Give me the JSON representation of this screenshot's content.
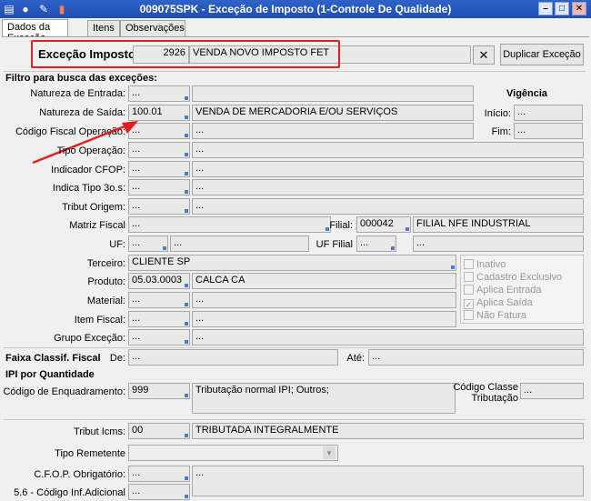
{
  "window": {
    "title": "009075SPK - Exceção de Imposto (1-Controle De Qualidade)",
    "min_label": "–",
    "max_label": "□",
    "close_label": "✕"
  },
  "tabs": [
    {
      "label": "Dados da Exceção"
    },
    {
      "label": "Itens"
    },
    {
      "label": "Observações"
    }
  ],
  "header": {
    "label": "Exceção Imposto",
    "code": "2926",
    "description": "VENDA NOVO IMPOSTO FET",
    "clear_icon": "✕",
    "duplicate_label": "Duplicar Exceção"
  },
  "filters": {
    "section_title": "Filtro para busca das exceções:",
    "vigencia_label": "Vigência",
    "inicio_label": "Início:",
    "inicio_value": "...",
    "fim_label": "Fim:",
    "fim_value": "...",
    "natureza_entrada": {
      "label": "Natureza de Entrada:",
      "code": "...",
      "desc": ""
    },
    "natureza_saida": {
      "label": "Natureza de Saída:",
      "code": "100.01",
      "desc": "VENDA DE MERCADORIA E/OU SERVIÇOS"
    },
    "cfop_operacao": {
      "label": "Código Fiscal Operação:",
      "code": "...",
      "desc": "..."
    },
    "tipo_operacao": {
      "label": "Tipo Operação:",
      "code": "...",
      "desc": "..."
    },
    "indicador_cfop": {
      "label": "Indicador CFOP:",
      "code": "...",
      "desc": "..."
    },
    "indica_tipo": {
      "label": "Indica Tipo 3o.s:",
      "code": "...",
      "desc": "..."
    },
    "tribut_origem": {
      "label": "Tribut Origem:",
      "code": "...",
      "desc": "..."
    },
    "matriz_fiscal": {
      "label": "Matriz Fiscal",
      "value": "..."
    },
    "filial": {
      "label": "Filial:",
      "code": "000042",
      "desc": "FILIAL NFE INDUSTRIAL"
    },
    "uf": {
      "label": "UF:",
      "code": "...",
      "desc": "..."
    },
    "uf_filial": {
      "label": "UF Filial",
      "code": "...",
      "desc": "..."
    },
    "terceiro": {
      "label": "Terceiro:",
      "value": "CLIENTE SP"
    },
    "produto": {
      "label": "Produto:",
      "code": "05.03.0003",
      "desc": "CALCA CA"
    },
    "material": {
      "label": "Material:",
      "code": "...",
      "desc": "..."
    },
    "item_fiscal": {
      "label": "Item Fiscal:",
      "code": "...",
      "desc": "..."
    },
    "grupo_excecao": {
      "label": "Grupo Exceção:",
      "code": "...",
      "desc": "..."
    },
    "checkboxes": [
      {
        "label": "Inativo",
        "checked": false
      },
      {
        "label": "Cadastro Exclusivo",
        "checked": false
      },
      {
        "label": "Aplica Entrada",
        "checked": false
      },
      {
        "label": "Aplica Saída",
        "checked": true
      },
      {
        "label": "Não Fatura",
        "checked": false
      }
    ]
  },
  "faixa": {
    "label": "Faixa Classif. Fiscal",
    "de_label": "De:",
    "de_value": "...",
    "ate_label": "Até:",
    "ate_value": "..."
  },
  "ipi": {
    "section_title": "IPI por Quantidade",
    "enquadramento_label": "Código de Enquadramento:",
    "enquadramento_code": "999",
    "enquadramento_desc": "Tributação normal IPI; Outros;",
    "classe_label_1": "Código Classe",
    "classe_label_2": "Tributação",
    "classe_value": "..."
  },
  "icms": {
    "tribut_label": "Tribut Icms:",
    "tribut_code": "00",
    "tribut_desc": "TRIBUTADA INTEGRALMENTE",
    "tipo_remetente_label": "Tipo Remetente",
    "cfop_obrig_label": "C.F.O.P. Obrigatório:",
    "cfop_obrig_code": "...",
    "cfop_obrig_desc": "...",
    "cod_inf_label": "5.6 - Código Inf.Adicional",
    "cod_inf_code": "..."
  },
  "colors": {
    "titlebar": "#1f4fae",
    "highlight": "#e02020",
    "lookup_corner": "#4a7bd1"
  }
}
